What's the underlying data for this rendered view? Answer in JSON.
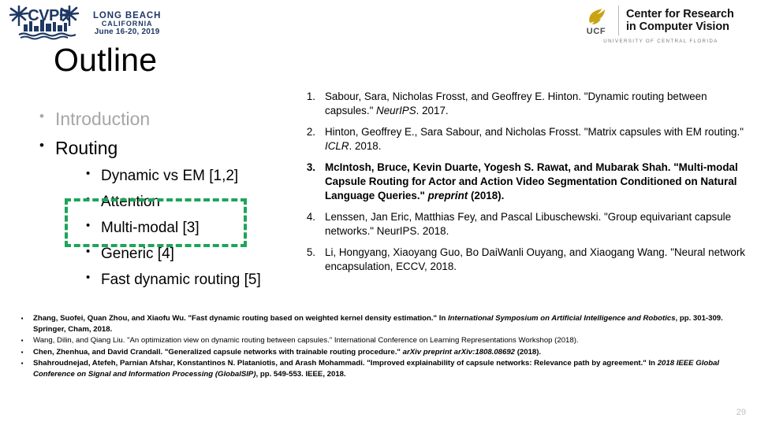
{
  "logos": {
    "cvpr": {
      "name": "cvpr-logo",
      "acronym": "CVPR",
      "line1": "LONG BEACH",
      "line2": "CALIFORNIA",
      "line3": "June 16-20, 2019",
      "color": "#1F3864"
    },
    "ucf": {
      "name": "ucf-crcv-logo",
      "abbr": "UCF",
      "title_line1": "Center for Research",
      "title_line2": "in Computer Vision",
      "tagline": "UNIVERSITY OF CENTRAL FLORIDA",
      "mark_color": "#C8A415"
    }
  },
  "title": "Outline",
  "outline": {
    "items": [
      {
        "label": "Introduction",
        "level": 1,
        "dim": true
      },
      {
        "label": "Routing",
        "level": 1,
        "dim": false
      }
    ],
    "subitems": [
      {
        "label": "Dynamic vs EM [1,2]"
      },
      {
        "label": "Attention"
      },
      {
        "label": "Multi-modal [3]"
      },
      {
        "label": "Generic [4]"
      },
      {
        "label": "Fast dynamic routing [5]"
      }
    ],
    "highlight": {
      "name": "highlight-box",
      "color": "#1DA55A",
      "style": "dashed",
      "covers": [
        "Attention",
        "Multi-modal [3]"
      ]
    }
  },
  "references": [
    {
      "number": "1.",
      "bold": false,
      "parts": [
        {
          "text": "Sabour, Sara, Nicholas Frosst, and Geoffrey E. Hinton. \"Dynamic routing between capsules.\" ",
          "italic": false
        },
        {
          "text": "NeurIPS",
          "italic": true
        },
        {
          "text": ". 2017.",
          "italic": false
        }
      ]
    },
    {
      "number": "2.",
      "bold": false,
      "parts": [
        {
          "text": "Hinton, Geoffrey E., Sara Sabour, and Nicholas Frosst. \"Matrix capsules with EM routing.\" ",
          "italic": false
        },
        {
          "text": "ICLR",
          "italic": true
        },
        {
          "text": ". 2018.",
          "italic": false
        }
      ]
    },
    {
      "number": "3.",
      "bold": true,
      "parts": [
        {
          "text": "McIntosh, Bruce, Kevin Duarte, Yogesh S. Rawat, and Mubarak Shah. \"Multi-modal Capsule Routing for Actor and Action Video Segmentation Conditioned on Natural Language Queries.\" ",
          "italic": false
        },
        {
          "text": "preprint",
          "italic": true
        },
        {
          "text": " (2018).",
          "italic": false
        }
      ]
    },
    {
      "number": "4.",
      "bold": false,
      "parts": [
        {
          "text": "Lenssen, Jan Eric, Matthias Fey, and Pascal Libuschewski. \"Group equivariant capsule networks.\" NeurIPS. 2018.",
          "italic": false
        }
      ]
    },
    {
      "number": "5.",
      "bold": false,
      "parts": [
        {
          "text": "Li, Hongyang, Xiaoyang Guo, Bo DaiWanli Ouyang, and Xiaogang Wang. \"Neural network encapsulation, ECCV, 2018.",
          "italic": false
        }
      ]
    }
  ],
  "footnotes": [
    {
      "bullet": "▪",
      "bold": true,
      "parts": [
        {
          "text": "Zhang, Suofei, Quan Zhou, and Xiaofu Wu. \"Fast dynamic routing based on weighted kernel density estimation.\" In ",
          "italic": false
        },
        {
          "text": "International Symposium on Artificial Intelligence and Robotics",
          "italic": true
        },
        {
          "text": ", pp. 301-309. Springer, Cham, 2018.",
          "italic": false
        }
      ]
    },
    {
      "bullet": "▪",
      "bold": false,
      "parts": [
        {
          "text": "Wang, Dilin, and Qiang Liu. \"An optimization view on dynamic routing between capsules.\" International Conference on Learning Representations Workshop (2018).",
          "italic": false
        }
      ]
    },
    {
      "bullet": "▪",
      "bold": true,
      "parts": [
        {
          "text": "Chen, Zhenhua, and David Crandall. \"Generalized capsule networks with trainable routing procedure.\" ",
          "italic": false
        },
        {
          "text": "arXiv preprint arXiv:1808.08692",
          "italic": true
        },
        {
          "text": " (2018).",
          "italic": false
        }
      ]
    },
    {
      "bullet": "▪",
      "bold": true,
      "parts": [
        {
          "text": "Shahroudnejad, Atefeh, Parnian Afshar, Konstantinos N. Plataniotis, and Arash Mohammadi. \"Improved explainability of capsule networks: Relevance path by agreement.\" In ",
          "italic": false
        },
        {
          "text": "2018 IEEE Global Conference on Signal and Information Processing (GlobalSIP)",
          "italic": true
        },
        {
          "text": ", pp. 549-553. IEEE, 2018.",
          "italic": false
        }
      ]
    }
  ],
  "slide_number": "29"
}
